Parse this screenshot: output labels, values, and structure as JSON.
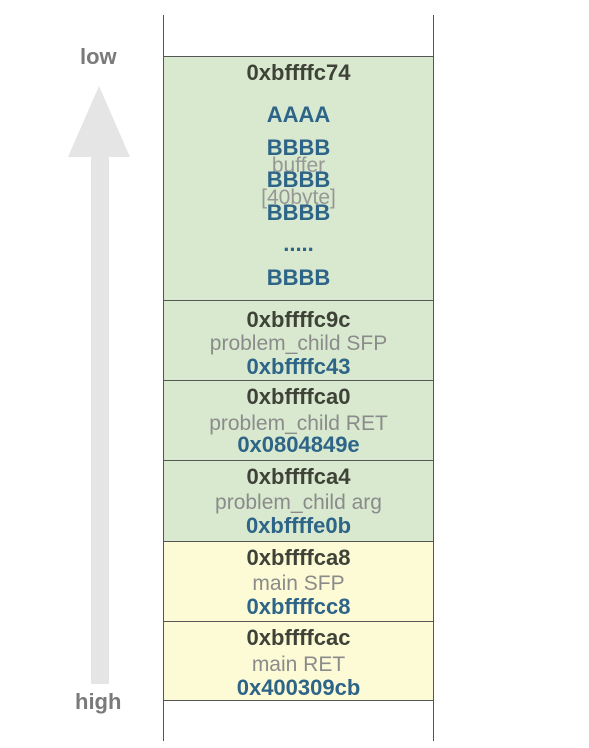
{
  "direction": {
    "low": "low",
    "high": "high"
  },
  "buffer": {
    "address": "0xbffffc74",
    "label": "buffer",
    "size_label": "[40byte]",
    "contents": [
      "AAAA",
      "BBBB",
      "BBBB",
      "BBBB",
      ".....",
      "BBBB"
    ]
  },
  "cells": [
    {
      "address": "0xbffffc9c",
      "label": "problem_child SFP",
      "value": "0xbffffc43"
    },
    {
      "address": "0xbffffca0",
      "label": "problem_child RET",
      "value": "0x0804849e"
    },
    {
      "address": "0xbffffca4",
      "label": "problem_child arg",
      "value": "0xbffffe0b"
    },
    {
      "address": "0xbffffca8",
      "label": "main SFP",
      "value": "0xbffffcc8"
    },
    {
      "address": "0xbffffcac",
      "label": "main RET",
      "value": "0x400309cb"
    }
  ],
  "colors": {
    "problem_child_frame": "#d8e9cf",
    "main_frame": "#fcfbd6",
    "address_text": "#3e4237",
    "value_text": "#2d6487",
    "label_text": "#8b8b8b",
    "arrow": "#e5e5e5"
  }
}
